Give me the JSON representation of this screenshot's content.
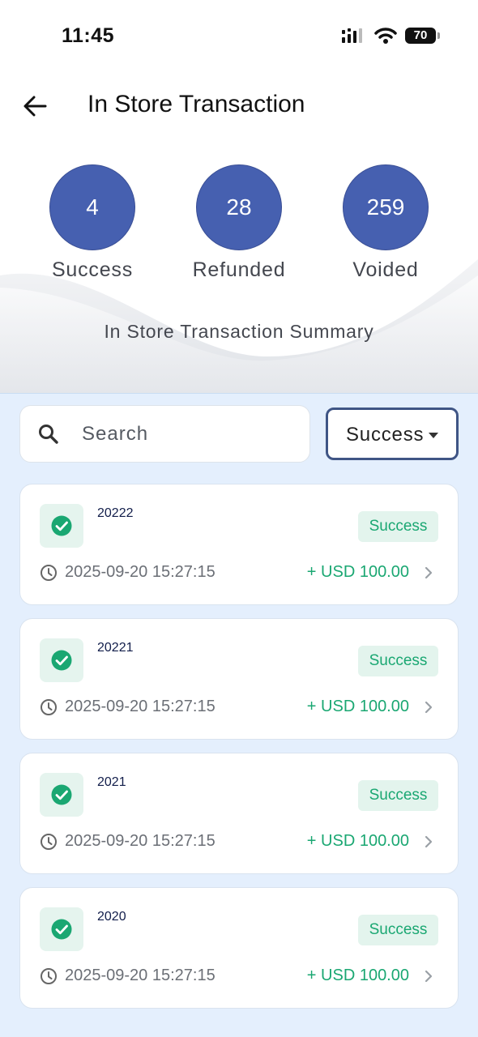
{
  "status_bar": {
    "time": "11:45",
    "battery": "70"
  },
  "header": {
    "title": "In Store Transaction"
  },
  "stats": [
    {
      "value": "4",
      "label": "Success"
    },
    {
      "value": "28",
      "label": "Refunded"
    },
    {
      "value": "259",
      "label": "Voided"
    }
  ],
  "summary_title": "In Store Transaction Summary",
  "search": {
    "placeholder": "Search",
    "value": ""
  },
  "filter": {
    "selected": "Success"
  },
  "transactions": [
    {
      "id": "20222",
      "status": "Success",
      "datetime": "2025-09-20 15:27:15",
      "amount": "+ USD 100.00"
    },
    {
      "id": "20221",
      "status": "Success",
      "datetime": "2025-09-20 15:27:15",
      "amount": "+ USD 100.00"
    },
    {
      "id": "2021",
      "status": "Success",
      "datetime": "2025-09-20 15:27:15",
      "amount": "+ USD 100.00"
    },
    {
      "id": "2020",
      "status": "Success",
      "datetime": "2025-09-20 15:27:15",
      "amount": "+ USD 100.00"
    }
  ],
  "colors": {
    "stat_circle": "#4660b0",
    "success_green": "#1aa772",
    "page_background": "#e4effd",
    "filter_border": "#3f5585"
  },
  "icons": [
    "back-arrow-icon",
    "search-icon",
    "dropdown-caret-icon",
    "check-circle-icon",
    "clock-icon",
    "chevron-right-icon",
    "signal-icon",
    "wifi-icon",
    "battery-icon"
  ]
}
